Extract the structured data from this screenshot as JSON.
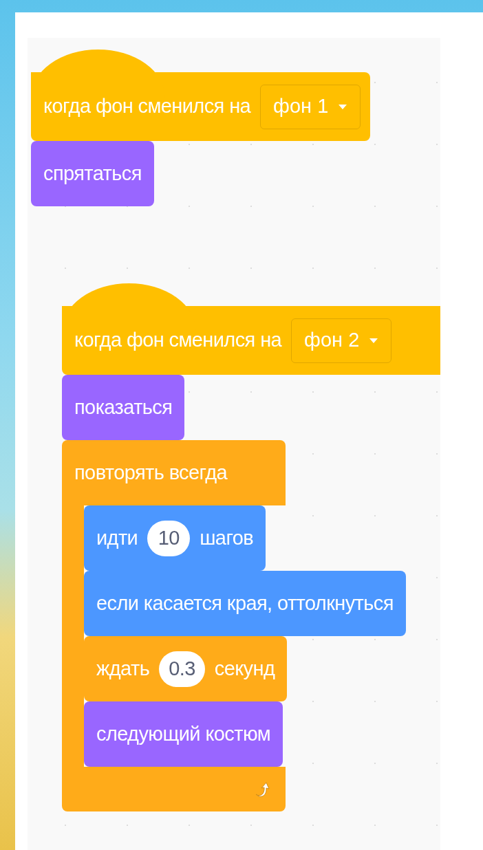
{
  "scripts": [
    {
      "hat": {
        "color": "#ffbf00",
        "parts": [
          {
            "kind": "text",
            "text": "когда фон сменился на"
          },
          {
            "kind": "dropdown",
            "text": "фон 1"
          }
        ]
      },
      "blocks": [
        {
          "kind": "stack",
          "color": "#9966ff",
          "parts": [
            {
              "kind": "text",
              "text": "спрятаться"
            }
          ]
        }
      ]
    },
    {
      "hat": {
        "color": "#ffbf00",
        "parts": [
          {
            "kind": "text",
            "text": "когда фон сменился на"
          },
          {
            "kind": "dropdown",
            "text": "фон 2"
          }
        ]
      },
      "blocks": [
        {
          "kind": "stack",
          "color": "#9966ff",
          "parts": [
            {
              "kind": "text",
              "text": "показаться"
            }
          ]
        },
        {
          "kind": "forever",
          "color": "#ffab19",
          "parts": [
            {
              "kind": "text",
              "text": "повторять всегда"
            }
          ],
          "children": [
            {
              "kind": "stack",
              "color": "#4c97ff",
              "parts": [
                {
                  "kind": "text",
                  "text": "идти"
                },
                {
                  "kind": "input",
                  "text": "10"
                },
                {
                  "kind": "text",
                  "text": "шагов"
                }
              ]
            },
            {
              "kind": "stack",
              "color": "#4c97ff",
              "parts": [
                {
                  "kind": "text",
                  "text": "если касается края, оттолкнуться"
                }
              ]
            },
            {
              "kind": "stack",
              "color": "#ffab19",
              "parts": [
                {
                  "kind": "text",
                  "text": "ждать"
                },
                {
                  "kind": "input",
                  "text": "0.3"
                },
                {
                  "kind": "text",
                  "text": "секунд"
                }
              ]
            },
            {
              "kind": "stack",
              "color": "#9966ff",
              "parts": [
                {
                  "kind": "text",
                  "text": "следующий костюм"
                }
              ]
            }
          ]
        }
      ]
    }
  ]
}
